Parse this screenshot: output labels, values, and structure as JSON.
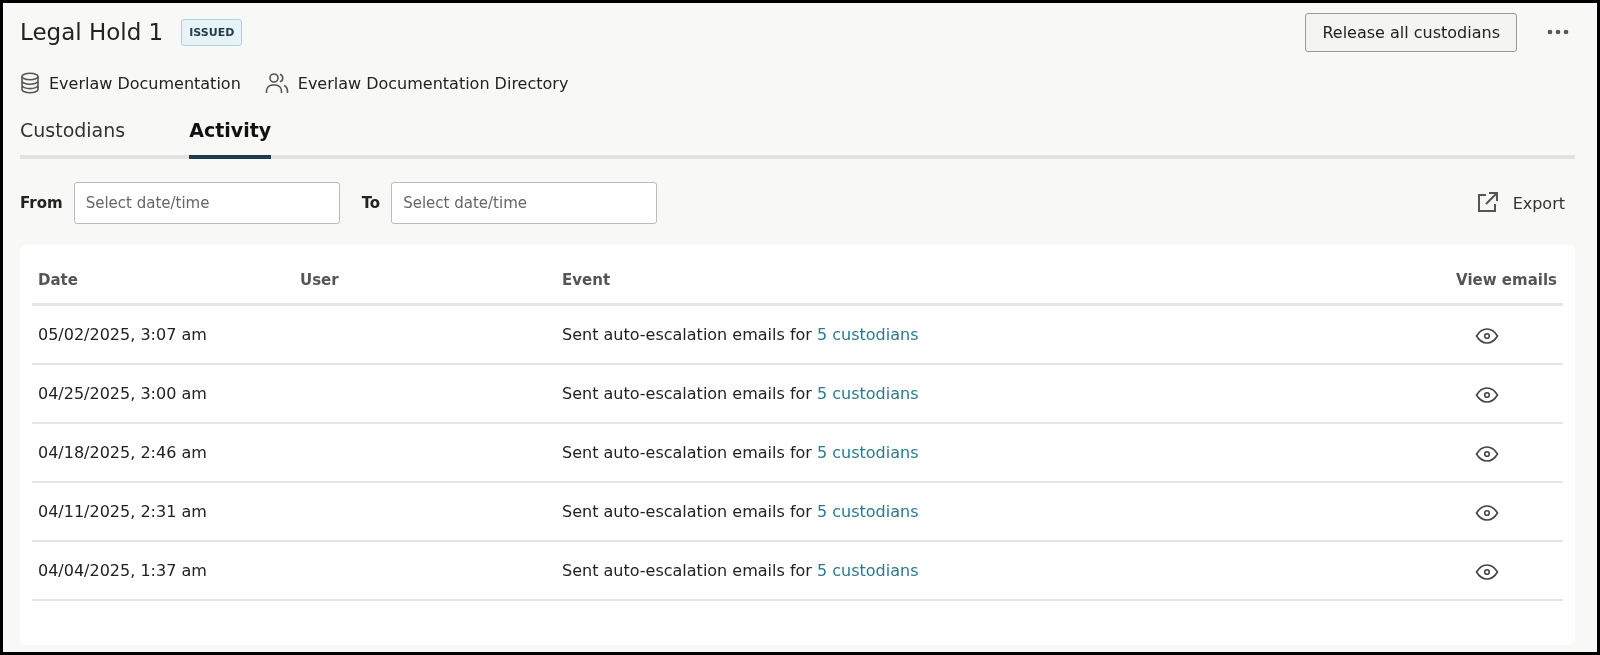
{
  "header": {
    "title": "Legal Hold 1",
    "status_badge": "ISSUED",
    "release_button": "Release all custodians"
  },
  "meta": [
    {
      "kind": "database",
      "label": "Everlaw Documentation"
    },
    {
      "kind": "people",
      "label": "Everlaw Documentation Directory"
    }
  ],
  "tabs": [
    {
      "label": "Custodians",
      "selected": false
    },
    {
      "label": "Activity",
      "selected": true
    }
  ],
  "filters": {
    "from_label": "From",
    "from_placeholder": "Select date/time",
    "to_label": "To",
    "to_placeholder": "Select date/time",
    "export": "Export"
  },
  "table": {
    "columns": [
      "Date",
      "User",
      "Event",
      "View emails"
    ],
    "rows": [
      {
        "date": "05/02/2025, 3:07 am",
        "event": "Sent auto-escalation emails for",
        "link": "5 custodians"
      },
      {
        "date": "04/25/2025, 3:00 am",
        "event": "Sent auto-escalation emails for",
        "link": "5 custodians"
      },
      {
        "date": "04/18/2025, 2:46 am",
        "event": "Sent auto-escalation emails for",
        "link": "5 custodians"
      },
      {
        "date": "04/11/2025, 2:31 am",
        "event": "Sent auto-escalation emails for",
        "link": "5 custodians"
      },
      {
        "date": "04/04/2025, 1:37 am",
        "event": "Sent auto-escalation emails for",
        "link": "5 custodians"
      }
    ]
  }
}
